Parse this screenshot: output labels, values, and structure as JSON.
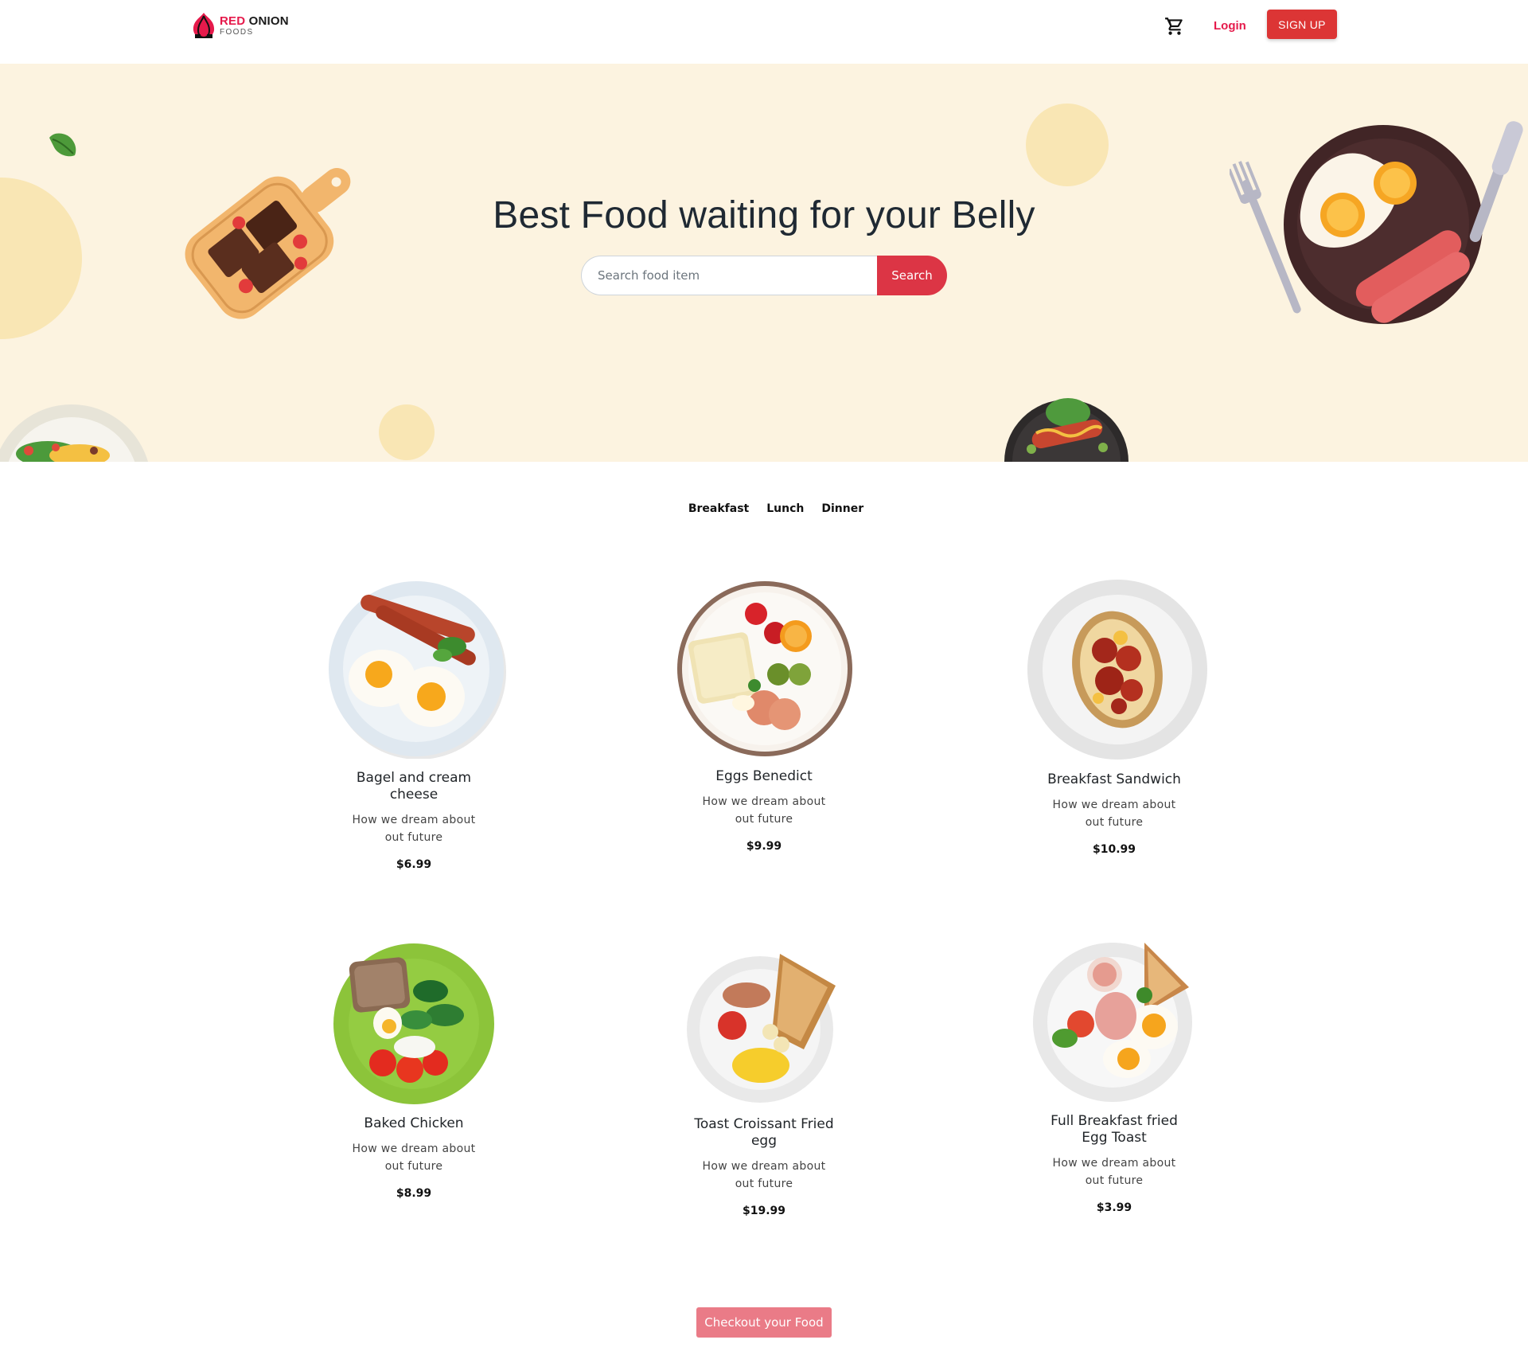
{
  "brand": {
    "name_red": "RED",
    "name_dark": "ONION",
    "tagline": "FOODS"
  },
  "nav": {
    "login_label": "Login",
    "signup_label": "SIGN UP"
  },
  "hero": {
    "title": "Best Food waiting for your Belly",
    "search_placeholder": "Search food item",
    "search_button": "Search"
  },
  "tabs": [
    "Breakfast",
    "Lunch",
    "Dinner"
  ],
  "foods": [
    {
      "name": "Bagel and cream cheese",
      "desc": "How we dream about out future",
      "price": "$6.99"
    },
    {
      "name": "Eggs Benedict",
      "desc": "How we dream about out future",
      "price": "$9.99"
    },
    {
      "name": "Breakfast Sandwich",
      "desc": "How we dream about out future",
      "price": "$10.99"
    },
    {
      "name": "Baked Chicken",
      "desc": "How we dream about out future",
      "price": "$8.99"
    },
    {
      "name": "Toast Croissant Fried egg",
      "desc": "How we dream about out future",
      "price": "$19.99"
    },
    {
      "name": "Full Breakfast fried Egg Toast",
      "desc": "How we dream about out future",
      "price": "$3.99"
    }
  ],
  "checkout_label": "Checkout your Food",
  "colors": {
    "brand_red": "#dc3545",
    "hero_bg": "#fcf3e0",
    "checkout_bg": "#ea7b87"
  }
}
